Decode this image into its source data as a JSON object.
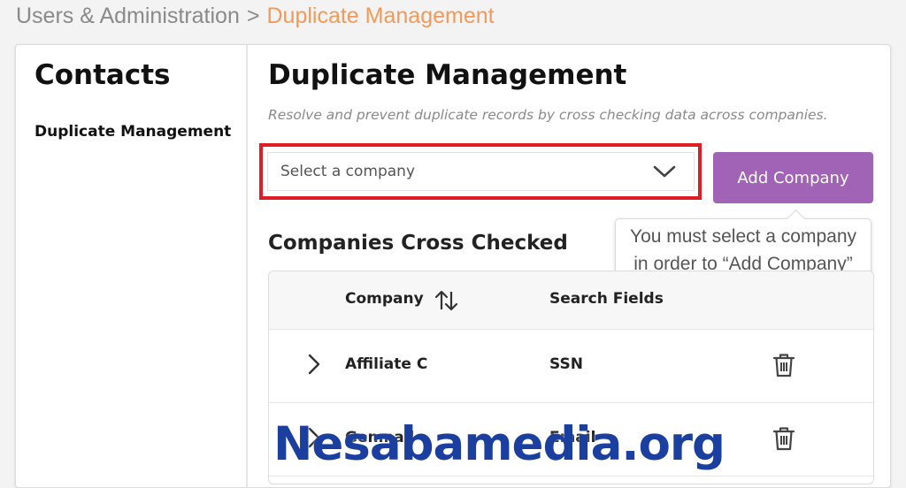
{
  "breadcrumb": {
    "parent": "Users & Administration",
    "separator": ">",
    "current": "Duplicate Management"
  },
  "sidebar": {
    "title": "Contacts",
    "items": [
      {
        "label": "Duplicate Management"
      }
    ]
  },
  "main": {
    "title": "Duplicate Management",
    "subtitle": "Resolve and prevent duplicate records by cross checking data across companies.",
    "company_select": {
      "placeholder": "Select a company",
      "icon": "chevron-down-icon"
    },
    "add_button": {
      "label": "Add Company",
      "color": "#a163b5"
    },
    "tooltip": {
      "line1": "You must select a company",
      "line2": "in order to “Add Company”"
    },
    "section_title": "Companies Cross Checked",
    "table": {
      "columns": [
        "Company",
        "Search Fields"
      ],
      "rows": [
        {
          "company": "Affiliate C",
          "search_fields": "SSN"
        },
        {
          "company": "Genmail",
          "search_fields": "Email"
        }
      ]
    }
  },
  "highlight_color": "#e01c24",
  "watermark": "Nesabamedia.org"
}
